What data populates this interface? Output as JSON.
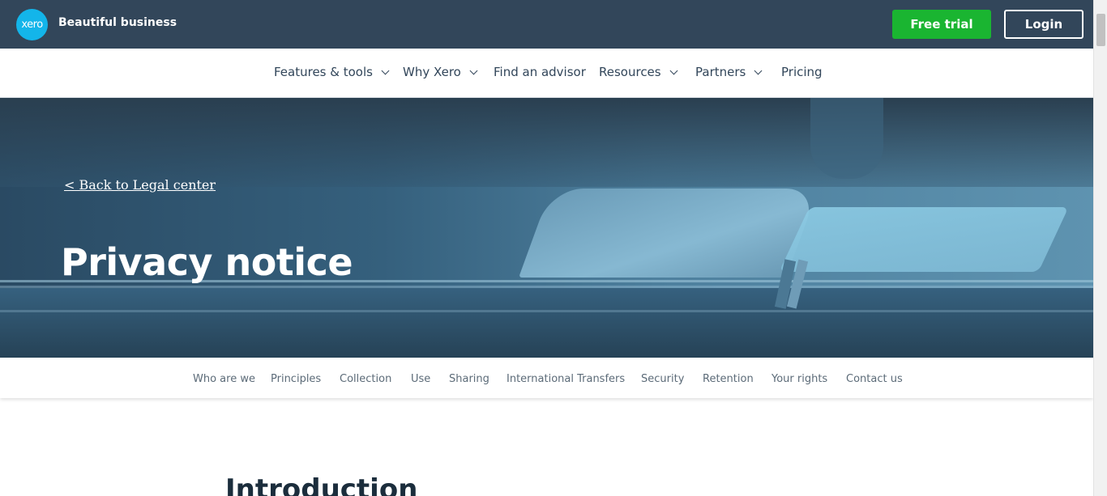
{
  "header": {
    "logo_text": "xero",
    "tagline": "Beautiful business",
    "free_trial_label": "Free trial",
    "login_label": "Login"
  },
  "nav": {
    "items": [
      {
        "label": "Features & tools",
        "has_dropdown": true
      },
      {
        "label": "Why Xero",
        "has_dropdown": true
      },
      {
        "label": "Find an advisor",
        "has_dropdown": false
      },
      {
        "label": "Resources",
        "has_dropdown": true
      },
      {
        "label": "Partners",
        "has_dropdown": true
      },
      {
        "label": "Pricing",
        "has_dropdown": false
      }
    ]
  },
  "hero": {
    "back_link": "< Back to Legal center",
    "title": "Privacy notice"
  },
  "section_nav": {
    "items": [
      "Who are we",
      "Principles",
      "Collection",
      "Use",
      "Sharing",
      "International Transfers",
      "Security",
      "Retention",
      "Your rights",
      "Contact us"
    ]
  },
  "content": {
    "heading": "Introduction"
  },
  "colors": {
    "topbar": "#32465a",
    "trial_green": "#1ab531",
    "logo_blue": "#13b5ea"
  }
}
